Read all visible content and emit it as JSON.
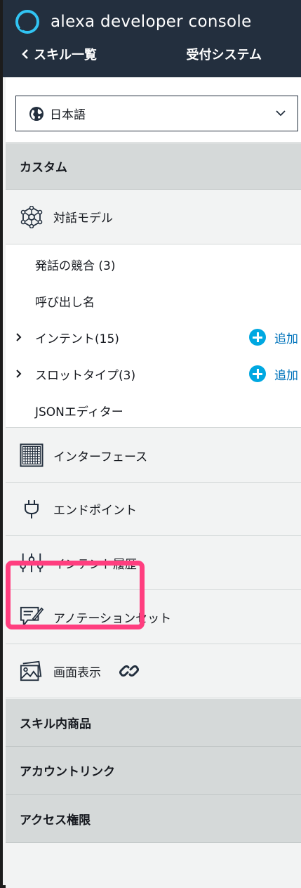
{
  "header": {
    "app_title": "alexa developer console",
    "back_label": "スキル一覧",
    "skill_name": "受付システム"
  },
  "language_select": {
    "value": "日本語"
  },
  "sections": {
    "custom": "カスタム",
    "in_skill_products": "スキル内商品",
    "account_linking": "アカウントリンク",
    "access_permissions": "アクセス権限"
  },
  "nav": {
    "interaction_model": "対話モデル",
    "interfaces": "インターフェース",
    "endpoint": "エンドポイント",
    "intent_history": "インテント履歴",
    "annotation_sets": "アノテーションセット",
    "display": "画面表示"
  },
  "interaction_model_items": [
    {
      "label": "発話の競合 (3)"
    },
    {
      "label": "呼び出し名"
    },
    {
      "label": "インテント(15)",
      "action": "追加"
    },
    {
      "label": "スロットタイプ(3)",
      "action": "追加"
    },
    {
      "label": "JSONエディター"
    }
  ],
  "colors": {
    "header_bg": "#232f3e",
    "section_bg": "#d5d9d9",
    "add_icon": "#00a8e1",
    "add_text": "#0073bb",
    "highlight": "#ff3e7f"
  }
}
